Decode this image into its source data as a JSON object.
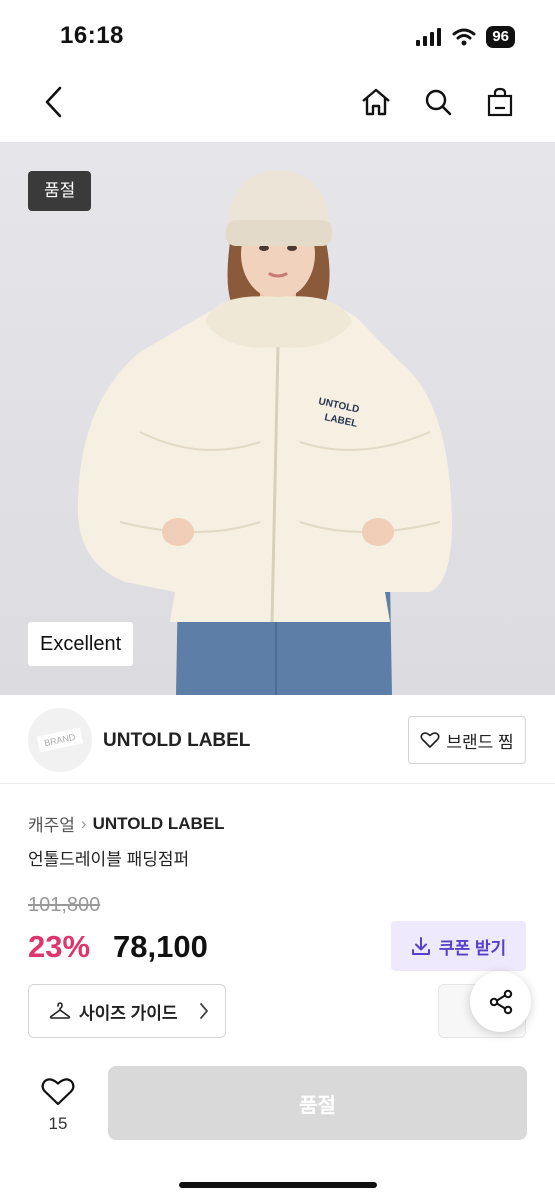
{
  "status_bar": {
    "time": "16:18",
    "battery": "96"
  },
  "product": {
    "soldout_tag": "품절",
    "grade": "Excellent",
    "jacket_print_line1": "UNTOLD",
    "jacket_print_line2": "LABEL"
  },
  "brand": {
    "logo_text": "BRAND",
    "name": "UNTOLD LABEL",
    "like_label": "브랜드 찜"
  },
  "breadcrumb": {
    "category": "캐주얼",
    "separator": "›",
    "brand": "UNTOLD LABEL"
  },
  "title": "언톨드레이블 패딩점퍼",
  "price": {
    "original": "101,800",
    "discount": "23%",
    "final": "78,100"
  },
  "coupon_label": "쿠폰 받기",
  "size_guide_label": "사이즈 가이드",
  "bottom": {
    "wish_count": "15",
    "buy_label": "품절"
  },
  "colors": {
    "discount": "#e0356a",
    "coupon_bg": "#efe9fd",
    "coupon_text": "#5a3fc8",
    "buy_disabled": "#d9d9d9"
  }
}
